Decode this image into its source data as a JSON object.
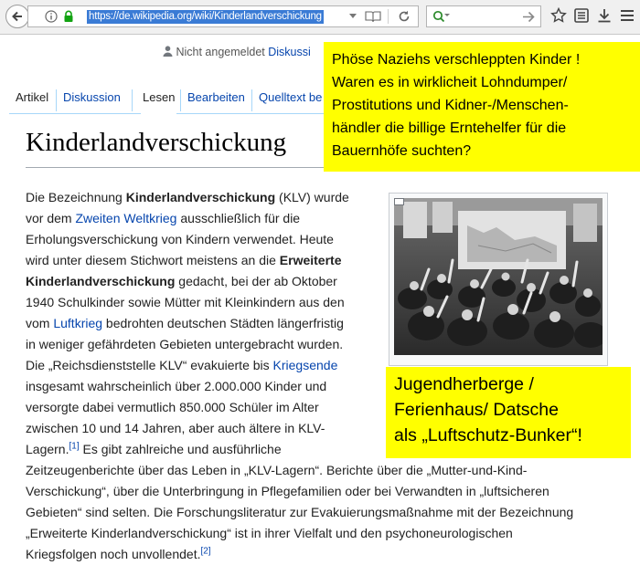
{
  "browser": {
    "url": "https://de.wikipedia.org/wiki/Kinderlandverschickung",
    "icons": [
      "back-arrow-icon",
      "info-icon",
      "lock-icon",
      "dropdown-icon",
      "reader-view-icon",
      "reload-icon",
      "search-icon",
      "search-go-icon",
      "bookmark-star-icon",
      "reading-list-icon",
      "download-icon",
      "menu-icon"
    ]
  },
  "wiki": {
    "user": {
      "anon": "Nicht angemeldet",
      "discussion": "Diskussi"
    },
    "tabs": {
      "artikel": "Artikel",
      "diskussion": "Diskussion",
      "lesen": "Lesen",
      "bearbeiten": "Bearbeiten",
      "quelltext": "Quelltext be"
    },
    "title": "Kinderlandverschickung",
    "p1": {
      "l1": "Die Bezeichnung ",
      "l1b": "Kinderlandverschickung",
      "l1c": " (KLV) wurde",
      "l2a": "vor dem ",
      "l2link": "Zweiten Weltkrieg",
      "l2b": " ausschließlich für die",
      "l3": "Erholungsverschickung von Kindern verwendet. Heute",
      "l4a": "wird unter diesem Stichwort meistens an die ",
      "l4b": "Erweiterte",
      "l5a": "Kinderlandverschickung",
      "l5b": " gedacht, bei der ab Oktober",
      "l6": "1940 Schulkinder sowie Mütter mit Kleinkindern aus den",
      "l7a": "vom ",
      "l7link": "Luftkrieg",
      "l7b": " bedrohten deutschen Städten längerfristig",
      "l8": "in weniger gefährdeten Gebieten untergebracht wurden.",
      "l9a": "Die „Reichsdienststelle KLV“ evakuierte bis ",
      "l9link": "Kriegsende",
      "l10": "insgesamt wahrscheinlich über 2.000.000 Kinder und",
      "l11": "versorgte dabei vermutlich 850.000 Schüler im Alter",
      "l12": "zwischen 10 und 14 Jahren, aber auch ältere in KLV-",
      "l13a": "Lagern.",
      "l13ref": "[1]",
      "l13b": " Es gibt zahlreiche und ausführliche",
      "l14": "Zeitzeugenberichte über das Leben in „KLV-Lagern“. Berichte über die „Mutter-und-Kind-",
      "l15": "Verschickung“, über die Unterbringung in Pflegefamilien oder bei Verwandten in „luftsicheren",
      "l16": "Gebieten“ sind selten. Die Forschungsliteratur zur Evakuierungsmaßnahme mit der Bezeichnung",
      "l17": "„Erweiterte Kinderlandverschickung“ ist in ihrer Vielfalt und den psychoneurologischen",
      "l18a": "Kriegsfolgen noch unvollendet.",
      "l18ref": "[2]"
    }
  },
  "overlays": {
    "top": [
      "Phöse Naziehs verschleppten Kinder !",
      "Waren es in wirklicheit Lohndumper/",
      "Prostitutions und Kidner-/Menschen-",
      "händler die billige Erntehelfer für die",
      "Bauernhöfe suchten?"
    ],
    "bottom": [
      "Jugendherberge /",
      "Ferienhaus/ Datsche",
      "als „Luftschutz-Bunker“!"
    ]
  }
}
